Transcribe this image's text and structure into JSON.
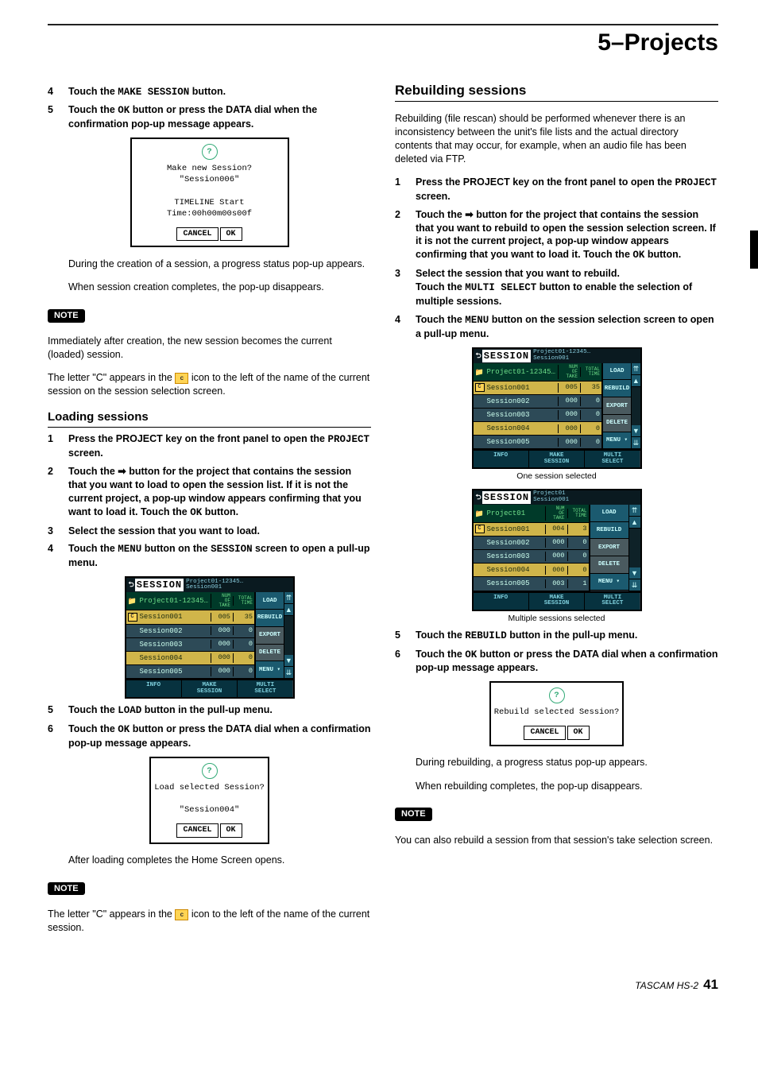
{
  "chapter": "5–Projects",
  "footer": {
    "product": "TASCAM HS-2",
    "page": "41"
  },
  "dialogs": {
    "make": {
      "line1": "Make new Session?",
      "line2": "\"Session006\"",
      "line3": "TIMELINE Start Time:00h00m00s00f"
    },
    "load": {
      "line1": "Load selected Session?",
      "line2": "\"Session004\""
    },
    "rebuild": {
      "line1": "Rebuild selected Session?"
    },
    "btn_cancel": "CANCEL",
    "btn_ok": "OK"
  },
  "left": {
    "s4": {
      "t1": "Touch the ",
      "m1": "MAKE SESSION",
      "t2": " button."
    },
    "s5": {
      "t1": "Touch the ",
      "m1": "OK",
      "t2": " button or press the DATA dial when the confirmation pop-up message appears."
    },
    "p_after1": "During the creation of a session, a progress status pop-up appears.",
    "p_after2": "When session creation completes, the pop-up disappears.",
    "note_label": "NOTE",
    "note1a": "Immediately after creation, the new session becomes the current (loaded) session.",
    "note1b_a": "The letter \"C\" appears in the ",
    "note1b_b": " icon to the left of the name of the current session on the session selection screen.",
    "h_loading": "Loading sessions",
    "ls1": {
      "t1": "Press the PROJECT key on the front panel to open the ",
      "m1": "PROJECT",
      "t2": " screen."
    },
    "ls2": {
      "t1": "Touch the ",
      "t2": " button for the project that contains the session that you want to load to open the session list. If it is not the current project, a pop-up window appears confirming that you want to load it. Touch the ",
      "m2": "OK",
      "t3": " button."
    },
    "ls3": "Select the session that you want to load.",
    "ls4": {
      "t1": "Touch the ",
      "m1": "MENU",
      "t2": " button on the ",
      "m2": "SESSION",
      "t3": " screen to open a pull-up menu."
    },
    "ls5": {
      "t1": "Touch the ",
      "m1": "LOAD",
      "t2": " button in the pull-up menu."
    },
    "ls6": {
      "t1": "Touch the ",
      "m1": "OK",
      "t2": " button or press the DATA dial when a confirmation pop-up message appears."
    },
    "p_after3": "After loading completes the Home Screen opens.",
    "note2_a": "The letter \"C\" appears in the ",
    "note2_b": " icon to the left of the name of the current session."
  },
  "right": {
    "h_rebuild": "Rebuilding sessions",
    "intro": "Rebuilding (file rescan) should be performed whenever there is an inconsistency between the unit's file lists and the actual directory contents that may occur, for example, when an audio file has been deleted via FTP.",
    "rs1": {
      "t1": "Press the PROJECT key on the front panel to open the ",
      "m1": "PROJECT",
      "t2": " screen."
    },
    "rs2": {
      "t1": "Touch the ",
      "t2": " button for the project that contains the session that you want to rebuild to open the session selection screen. If it is not the current project, a pop-up window appears confirming that you want to load it. Touch the ",
      "m2": "OK",
      "t3": " button."
    },
    "rs3a": "Select the session that you want to rebuild.",
    "rs3b": {
      "t1": "Touch the ",
      "m1": "MULTI SELECT",
      "t2": " button to enable the selection of multiple sessions."
    },
    "rs4": {
      "t1": "Touch the ",
      "m1": "MENU",
      "t2": " button on the session selection screen to open a pull-up menu."
    },
    "cap1": "One session selected",
    "cap2": "Multiple sessions selected",
    "rs5": {
      "t1": "Touch the ",
      "m1": "REBUILD",
      "t2": " button in the pull-up menu."
    },
    "rs6": {
      "t1": "Touch the ",
      "m1": "OK",
      "t2": " button or press the DATA dial when a confirmation pop-up message appears."
    },
    "p_after1": "During rebuilding, a progress status pop-up appears.",
    "p_after2": "When rebuilding completes, the pop-up disappears.",
    "note_label": "NOTE",
    "note1": "You can also rebuild a session from that session's take selection screen."
  },
  "screens": {
    "title_word": "SESSION",
    "col_hdr1": "NUM\nOF\nTAKE",
    "col_hdr2": "TOTAL\nTIME",
    "menu": {
      "load": "LOAD",
      "rebuild": "REBUILD",
      "export": "EXPORT",
      "delete": "DELETE",
      "menu": "MENU"
    },
    "foot": {
      "info": "INFO",
      "make": "MAKE\nSESSION",
      "multi": "MULTI\nSELECT"
    },
    "a": {
      "path1": "Project01-12345…",
      "path2": "Session001",
      "project": "Project01-12345…",
      "rows": [
        {
          "sel": true,
          "name": "Session001",
          "c1": "005",
          "c2": "35"
        },
        {
          "sel": false,
          "name": "Session002",
          "c1": "000",
          "c2": "0"
        },
        {
          "sel": false,
          "name": "Session003",
          "c1": "000",
          "c2": "0"
        },
        {
          "sel": true,
          "name": "Session004",
          "c1": "000",
          "c2": "0"
        },
        {
          "sel": false,
          "name": "Session005",
          "c1": "000",
          "c2": "0"
        }
      ]
    },
    "b": {
      "path1": "Project01-12345…",
      "path2": "Session001",
      "project": "Project01-12345…",
      "rows": [
        {
          "sel": true,
          "name": "Session001",
          "c1": "005",
          "c2": "35"
        },
        {
          "sel": false,
          "name": "Session002",
          "c1": "000",
          "c2": "0"
        },
        {
          "sel": false,
          "name": "Session003",
          "c1": "000",
          "c2": "0"
        },
        {
          "sel": true,
          "name": "Session004",
          "c1": "000",
          "c2": "0"
        },
        {
          "sel": false,
          "name": "Session005",
          "c1": "000",
          "c2": "0"
        }
      ]
    },
    "c": {
      "path1": "Project01",
      "path2": "Session001",
      "project": "Project01",
      "rows": [
        {
          "sel": true,
          "name": "Session001",
          "c1": "004",
          "c2": "3"
        },
        {
          "sel": false,
          "name": "Session002",
          "c1": "000",
          "c2": "0"
        },
        {
          "sel": false,
          "name": "Session003",
          "c1": "000",
          "c2": "0"
        },
        {
          "sel": true,
          "name": "Session004",
          "c1": "000",
          "c2": "0"
        },
        {
          "sel": false,
          "name": "Session005",
          "c1": "003",
          "c2": "1"
        }
      ]
    }
  }
}
